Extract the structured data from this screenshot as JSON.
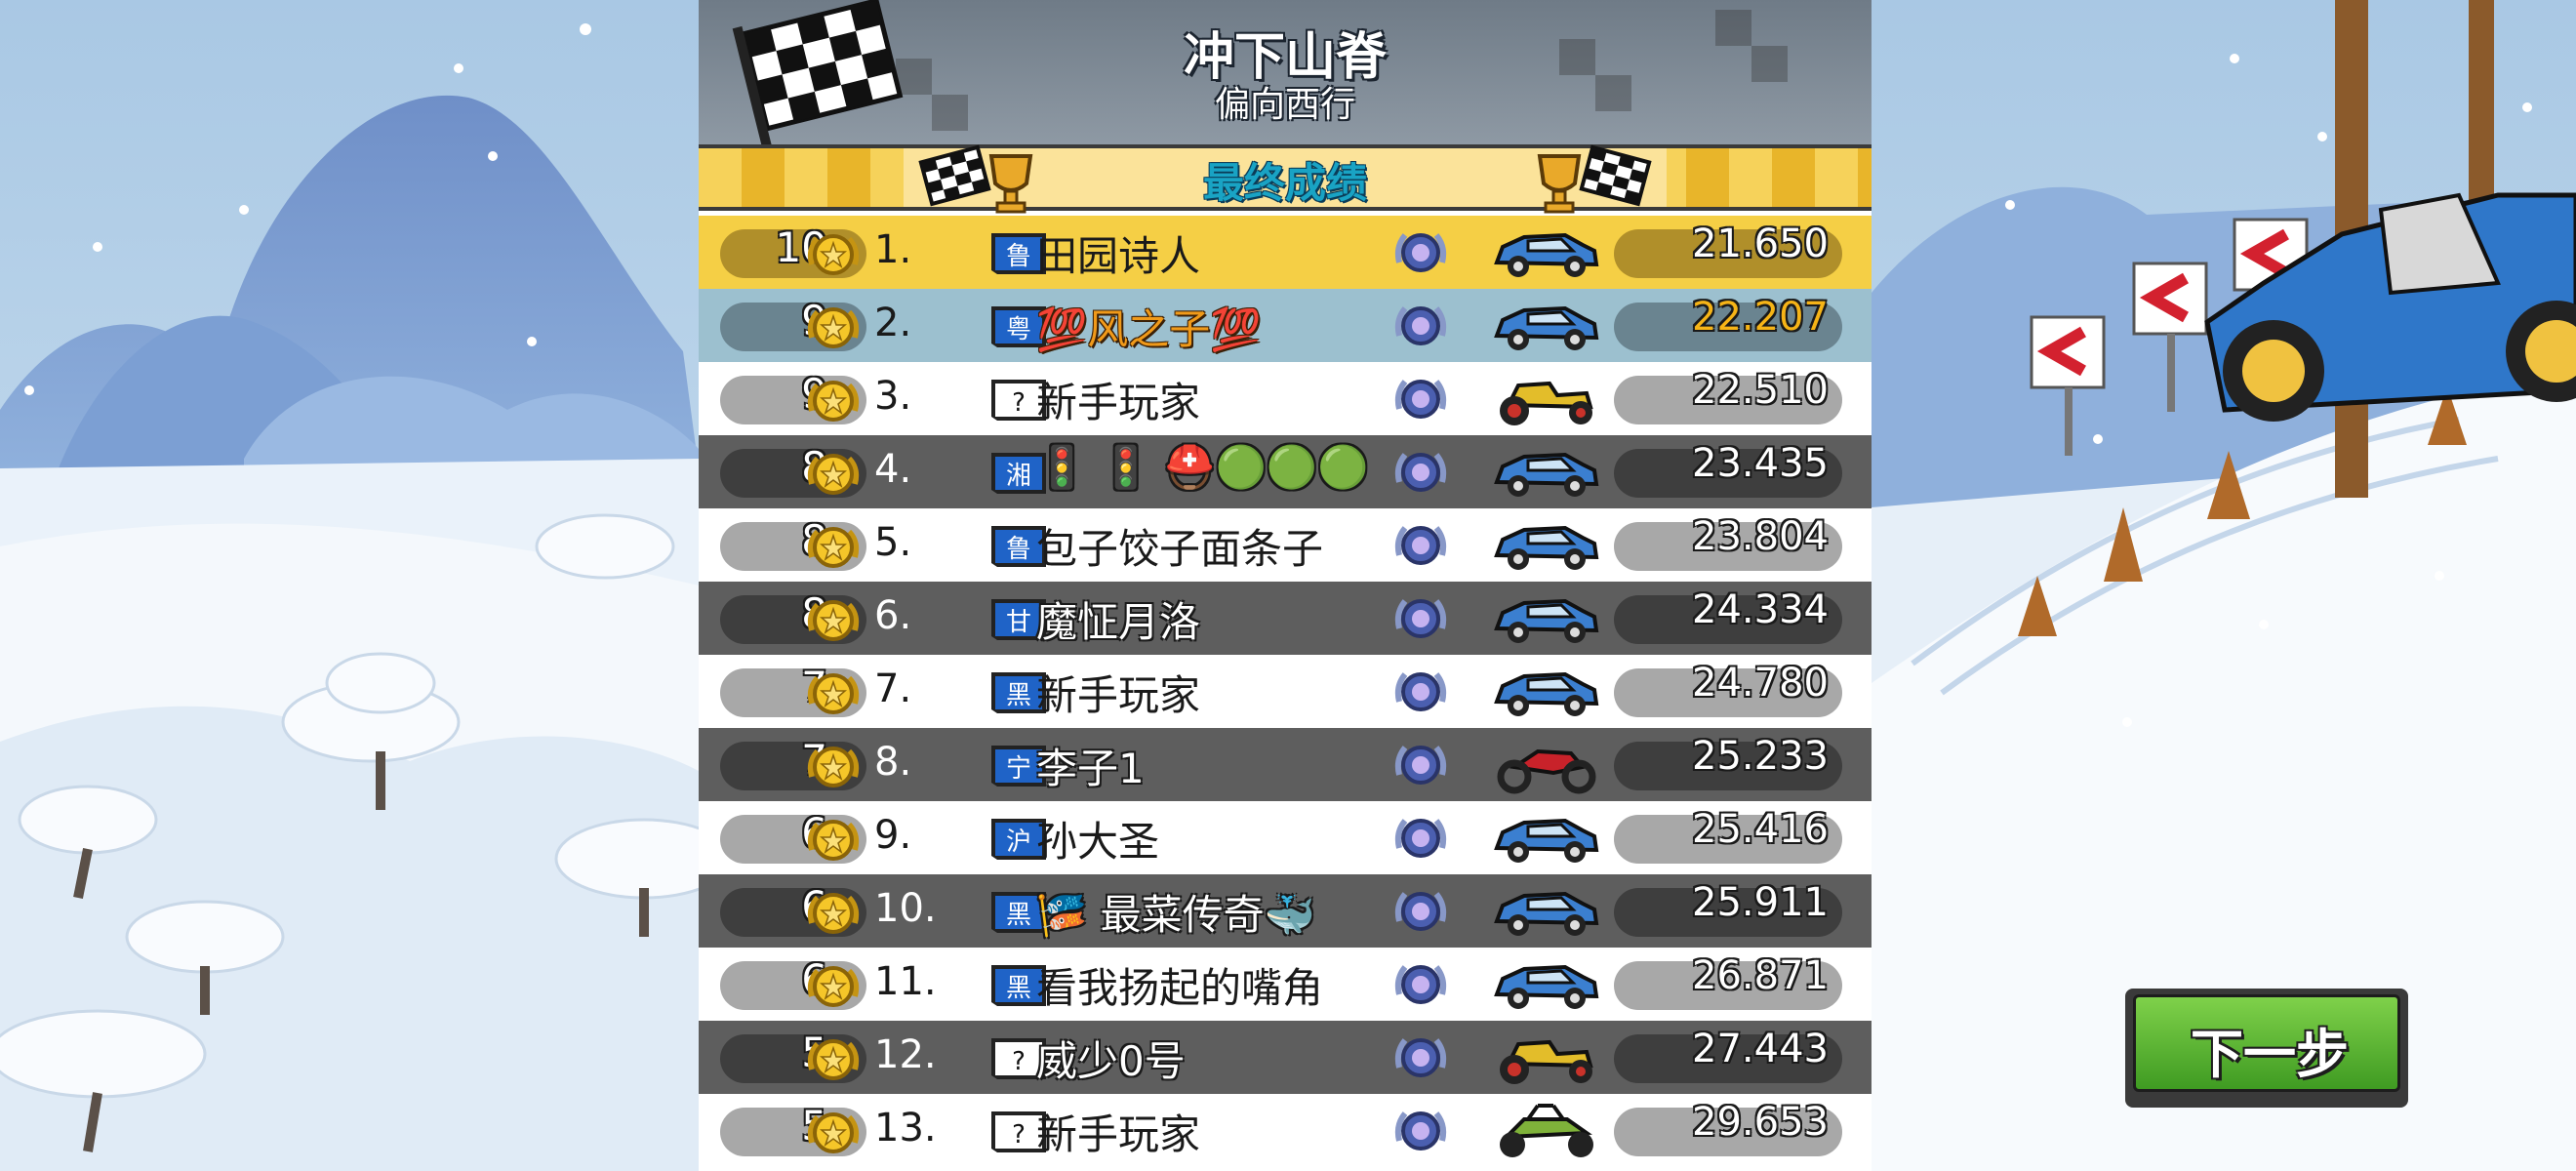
{
  "header": {
    "track_name": "冲下山脊",
    "track_subtitle": "偏向西行",
    "results_title": "最终成绩"
  },
  "results": [
    {
      "coins": "10",
      "rank": "1.",
      "badge": "鲁",
      "name": "田园诗人",
      "vehicle": "blue-rally-car",
      "time": "21.650",
      "theme": "gold"
    },
    {
      "coins": "9",
      "rank": "2.",
      "badge": "粤",
      "name": "💯风之子💯",
      "vehicle": "blue-rally-car",
      "time": "22.207",
      "theme": "blue",
      "highlight": true
    },
    {
      "coins": "9",
      "rank": "3.",
      "badge": "?",
      "name": "新手玩家",
      "vehicle": "yellow-hot-rod",
      "time": "22.510",
      "theme": "white"
    },
    {
      "coins": "8",
      "rank": "4.",
      "badge": "湘",
      "name": "🚦 🚦 ⛑️🟢🟢🟢",
      "vehicle": "blue-rally-car",
      "time": "23.435",
      "theme": "dark"
    },
    {
      "coins": "8",
      "rank": "5.",
      "badge": "鲁",
      "name": "包子饺子面条子",
      "vehicle": "blue-rally-car",
      "time": "23.804",
      "theme": "white"
    },
    {
      "coins": "8",
      "rank": "6.",
      "badge": "甘",
      "name": "魔怔月洛",
      "vehicle": "blue-rally-car",
      "time": "24.334",
      "theme": "dark"
    },
    {
      "coins": "7",
      "rank": "7.",
      "badge": "黑",
      "name": "新手玩家",
      "vehicle": "blue-rally-car",
      "time": "24.780",
      "theme": "white"
    },
    {
      "coins": "7",
      "rank": "8.",
      "badge": "宁",
      "name": "李子1",
      "vehicle": "red-motorbike",
      "time": "25.233",
      "theme": "dark"
    },
    {
      "coins": "6",
      "rank": "9.",
      "badge": "沪",
      "name": "孙大圣",
      "vehicle": "blue-rally-car",
      "time": "25.416",
      "theme": "white"
    },
    {
      "coins": "6",
      "rank": "10.",
      "badge": "黑",
      "name": "🎏 最菜传奇🐳",
      "vehicle": "blue-rally-car",
      "time": "25.911",
      "theme": "dark"
    },
    {
      "coins": "6",
      "rank": "11.",
      "badge": "黑",
      "name": "看我扬起的嘴角",
      "vehicle": "blue-rally-car",
      "time": "26.871",
      "theme": "white"
    },
    {
      "coins": "5",
      "rank": "12.",
      "badge": "?",
      "name": "威少0号",
      "vehicle": "yellow-hot-rod",
      "time": "27.443",
      "theme": "dark"
    },
    {
      "coins": "5",
      "rank": "13.",
      "badge": "?",
      "name": "新手玩家",
      "vehicle": "green-dune-buggy",
      "time": "29.653",
      "theme": "white"
    }
  ],
  "next_button": {
    "label": "下一步"
  },
  "colors": {
    "gold": "#f5cf45",
    "blue": "#9cc0cf",
    "dark": "#5e5e5e",
    "white": "#ffffff",
    "accent_green": "#4caf2a",
    "title_cyan": "#19a3c4"
  }
}
